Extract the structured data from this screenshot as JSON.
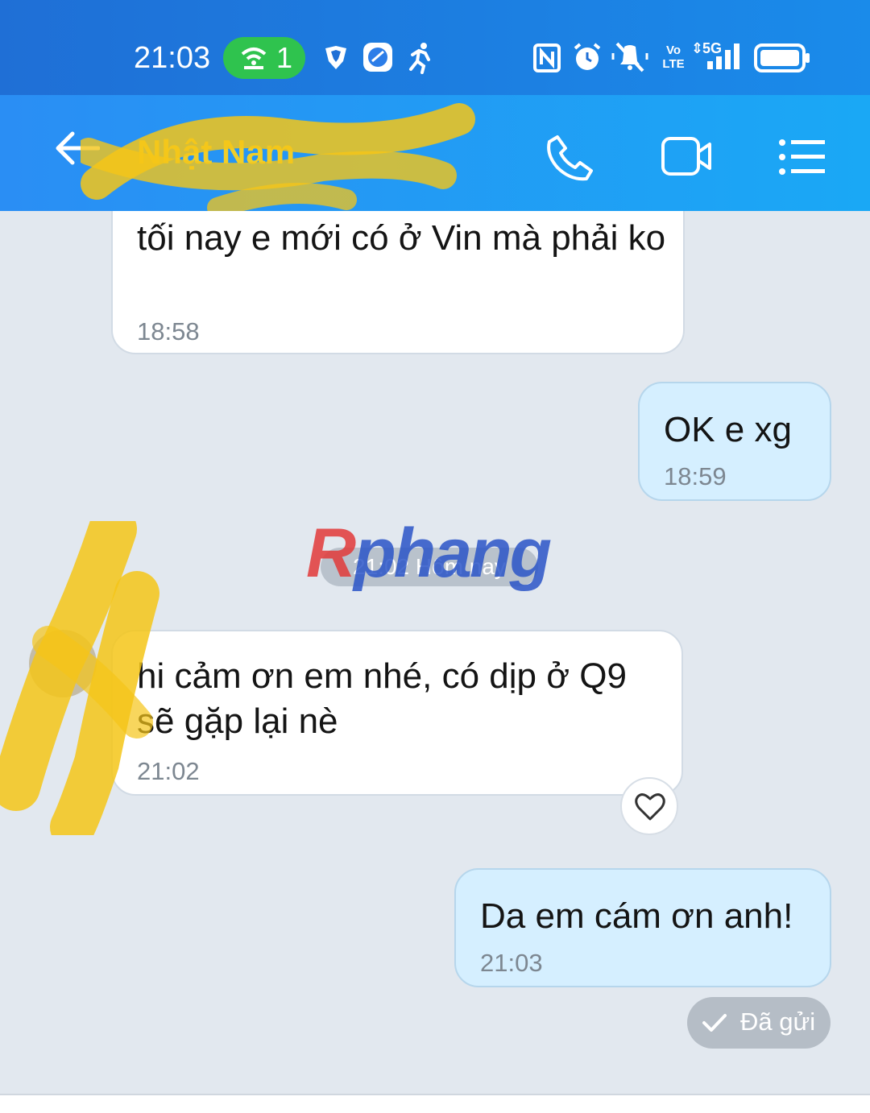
{
  "status_bar": {
    "time": "21:03",
    "hotspot_count": "1",
    "icons": [
      "hotspot-icon",
      "vpn-shield-icon",
      "app-icon",
      "running-icon",
      "nfc-icon",
      "alarm-icon",
      "mute-icon",
      "volte-icon",
      "signal-5g-icon",
      "battery-icon"
    ],
    "volte_label": "Vo LTE",
    "network_label": "5G"
  },
  "header": {
    "contact_name": "Nhật Nam",
    "icons": [
      "back-arrow-icon",
      "phone-icon",
      "video-camera-icon",
      "menu-list-icon"
    ]
  },
  "messages": [
    {
      "direction": "incoming",
      "text": "tối nay e mới có ở Vin mà phải ko",
      "time": "18:58"
    },
    {
      "direction": "outgoing",
      "text": "OK e xg",
      "time": "18:59"
    },
    {
      "direction": "incoming",
      "text": "hi cảm ơn em nhé, có dịp ở Q9 sẽ gặp lại nè",
      "time": "21:02"
    },
    {
      "direction": "outgoing",
      "text": "Da em cám ơn anh!",
      "time": "21:03"
    }
  ],
  "date_separator": "21:02 Hôm nay",
  "watermark": {
    "first": "R",
    "rest": "phang"
  },
  "sent_status": "Đã gửi",
  "colors": {
    "status_bar": "#1f6fd6",
    "header": "#2a8ef4",
    "chat_background": "#e2e8ef",
    "incoming_bubble": "#ffffff",
    "outgoing_bubble": "#d5efff",
    "hotspot_badge": "#2fc34e",
    "redaction": "#f5c518"
  }
}
